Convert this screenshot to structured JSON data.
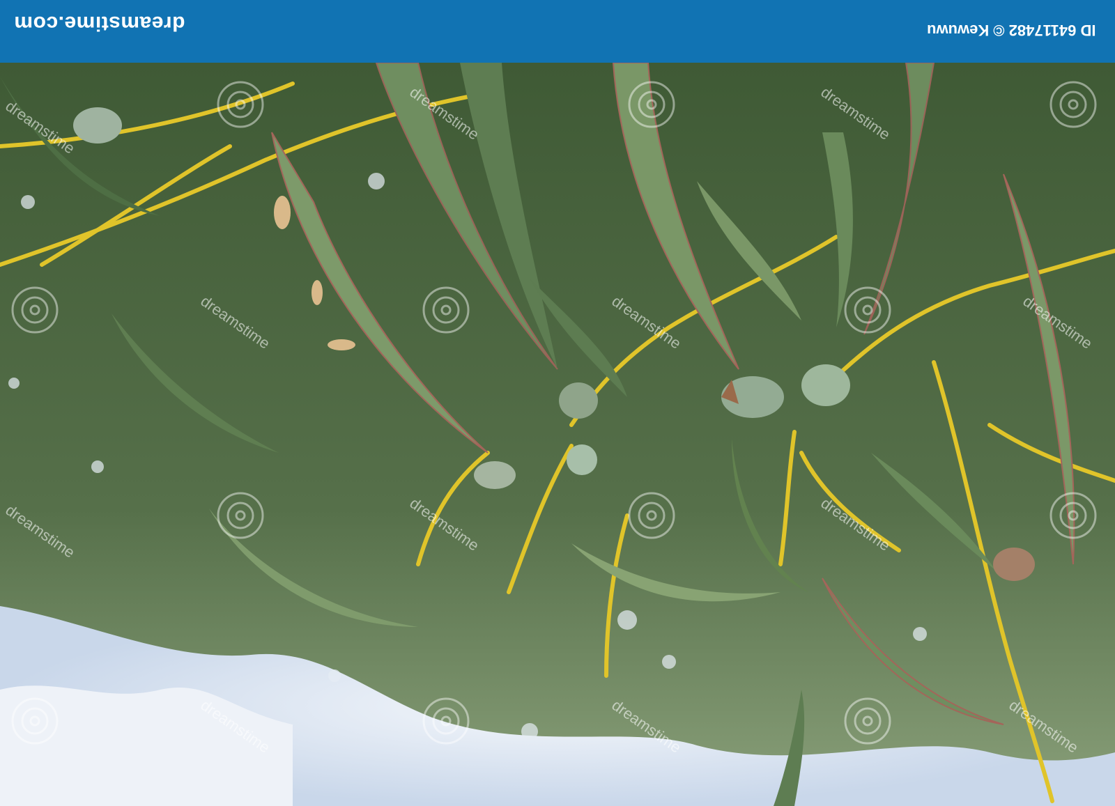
{
  "banner": {
    "brand": "dreamstime.com",
    "credit": "ID 64117482 © Kewuwu"
  },
  "watermark": {
    "text": "dreamstime"
  },
  "colors": {
    "banner": "#1173b3",
    "leaf_dark": "#4e6e44",
    "leaf_light": "#7d9a6a",
    "stem": "#e0c42a",
    "sky": "#dfe8f4"
  }
}
